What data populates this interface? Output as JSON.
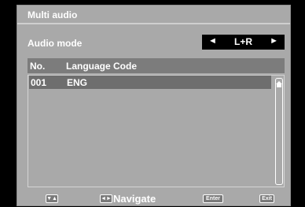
{
  "menu": {
    "title": "Multi audio"
  },
  "audio_mode": {
    "label": "Audio mode",
    "value": "L+R",
    "left_arrow": "◄",
    "right_arrow": "►"
  },
  "table": {
    "columns": [
      "No.",
      "Language Code"
    ],
    "rows": [
      {
        "no": "001",
        "code": "ENG",
        "selected": true
      }
    ]
  },
  "footer": {
    "up_down_icon": "▼▲",
    "navigate_icon": "◄►",
    "navigate_label": "Navigate",
    "enter_label": "Enter",
    "exit_label": "Exit"
  },
  "colors": {
    "panel": "#a9a9a9",
    "header_bar": "#7c7c7c",
    "selected_row": "#6e6e6e",
    "selector_bg": "#000000",
    "text": "#ffffff"
  }
}
